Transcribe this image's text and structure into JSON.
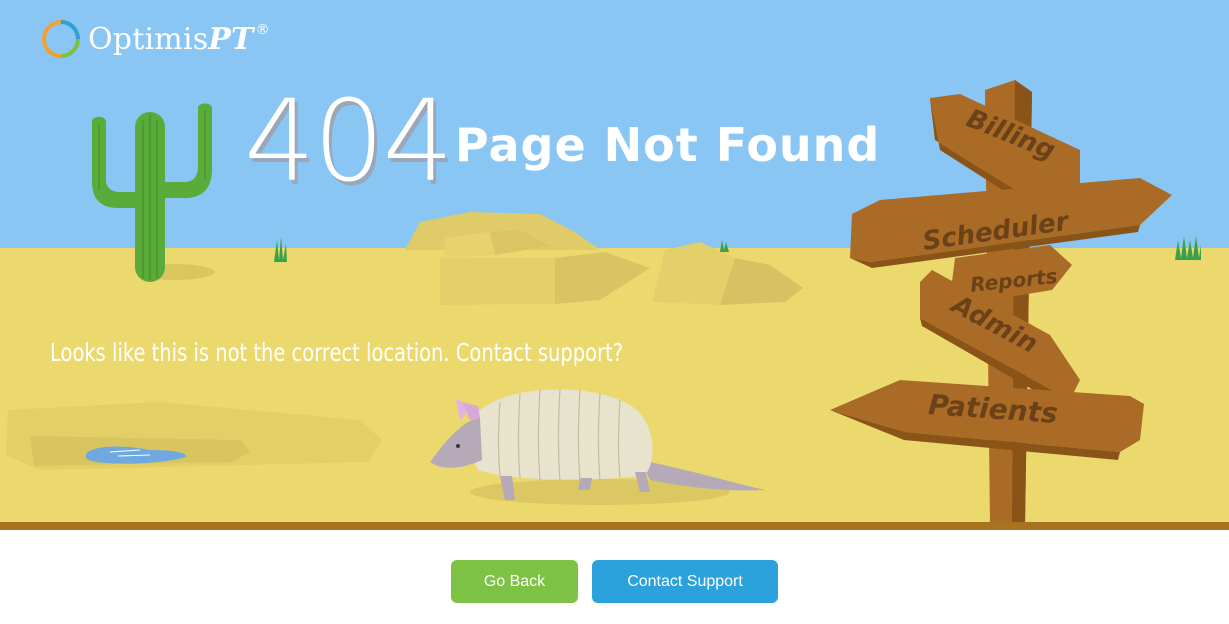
{
  "brand": {
    "name_prefix": "Optimis",
    "name_suffix": "PT",
    "registered": "®"
  },
  "error": {
    "code": "404",
    "title": "Page Not Found",
    "message": "Looks like this is not the correct location. Contact support?"
  },
  "signpost": {
    "signs": [
      "Billing",
      "Scheduler",
      "Reports",
      "Admin",
      "Patients"
    ]
  },
  "actions": {
    "go_back": "Go Back",
    "contact_support": "Contact Support"
  },
  "colors": {
    "sky": "#89c6f4",
    "sand": "#ebd96e",
    "ground_edge": "#a8731f",
    "wood": "#a96b26",
    "go_back_button": "#7dc244",
    "contact_button": "#2ba2dc"
  }
}
